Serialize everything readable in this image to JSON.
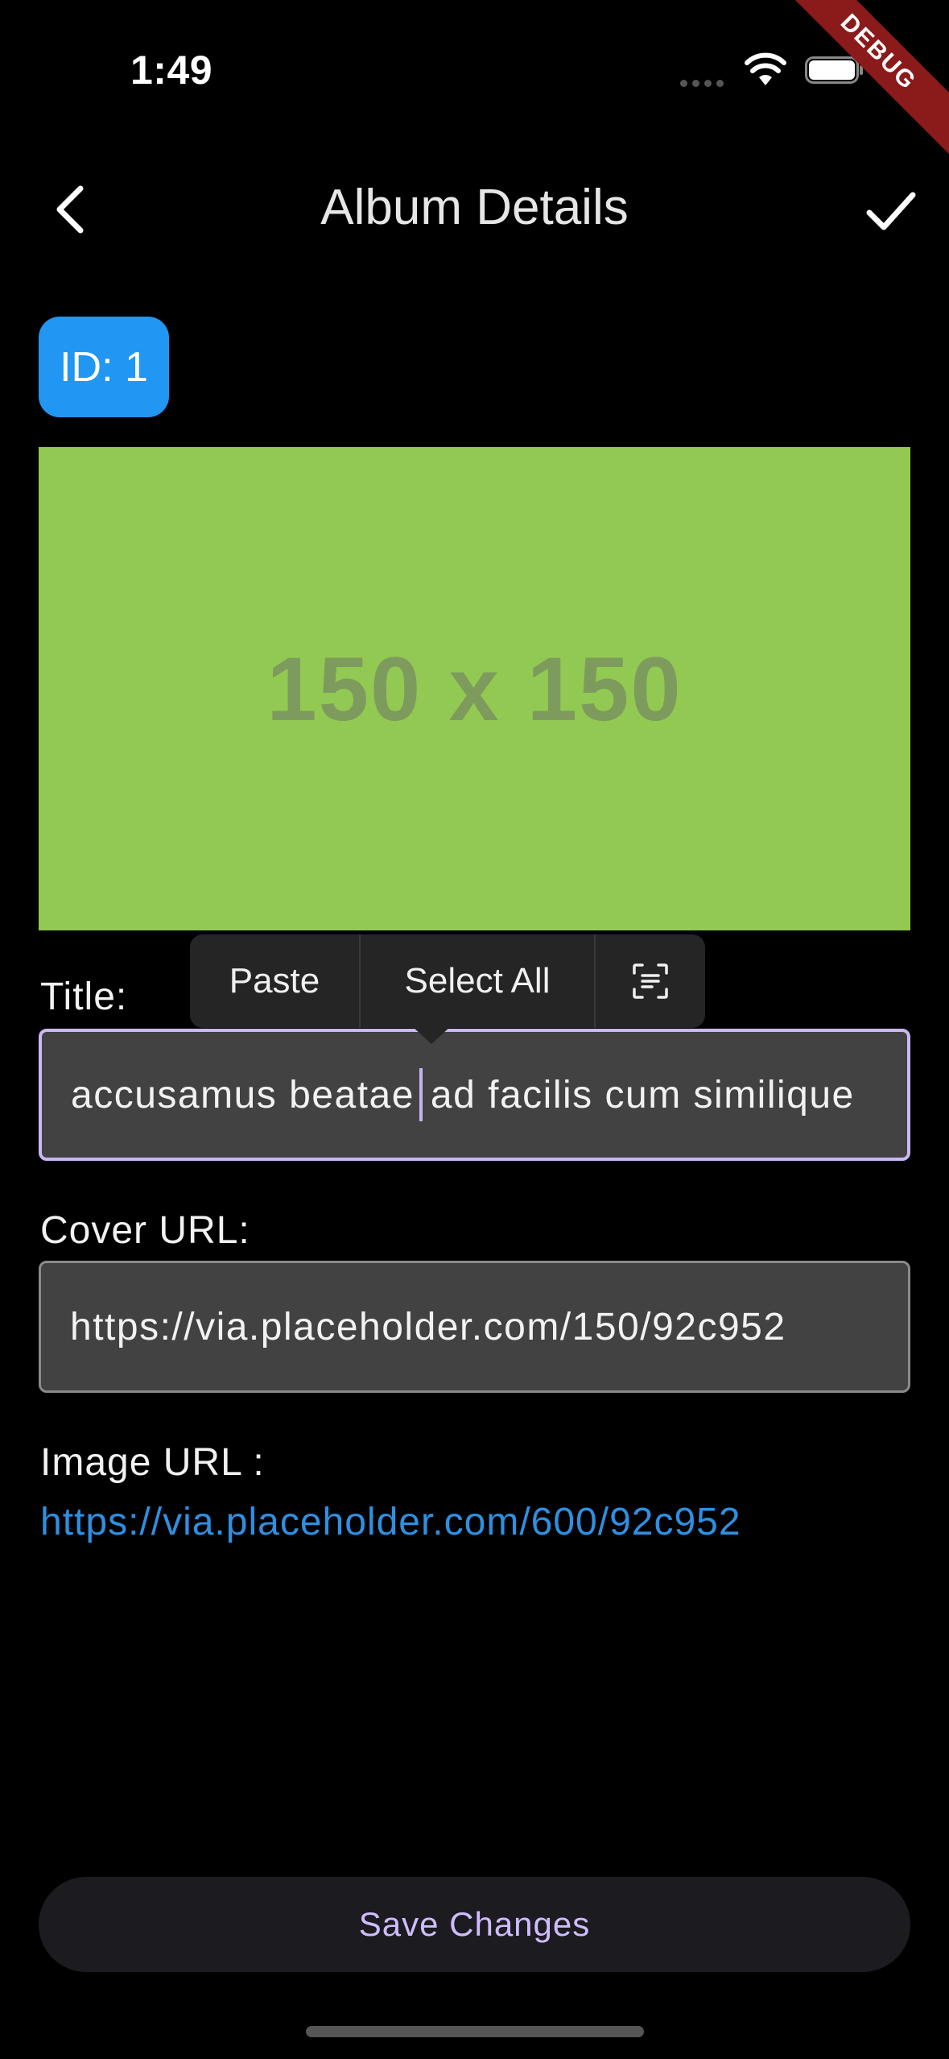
{
  "status_bar": {
    "time": "1:49"
  },
  "debug_banner": "DEBUG",
  "header": {
    "title": "Album Details"
  },
  "album": {
    "id_badge": "ID: 1"
  },
  "cover_image": {
    "placeholder_text": "150 x 150",
    "background": "#92c952"
  },
  "context_menu": {
    "paste": "Paste",
    "select_all": "Select All",
    "scan_icon": "text-scan-icon"
  },
  "title_field": {
    "label": "Title:",
    "value_before_caret": "accusamus beatae",
    "value_after_caret": "ad facilis cum similique"
  },
  "cover_url_field": {
    "label": "Cover URL:",
    "value": "https://via.placeholder.com/150/92c952"
  },
  "image_url": {
    "label": "Image URL :",
    "link": "https://via.placeholder.com/600/92c952"
  },
  "save_button": {
    "label": "Save Changes"
  },
  "colors": {
    "accent": "#2196f3",
    "focus_border": "#cbb8f5",
    "link": "#2f8fe0",
    "button_text": "#cfbcff"
  }
}
